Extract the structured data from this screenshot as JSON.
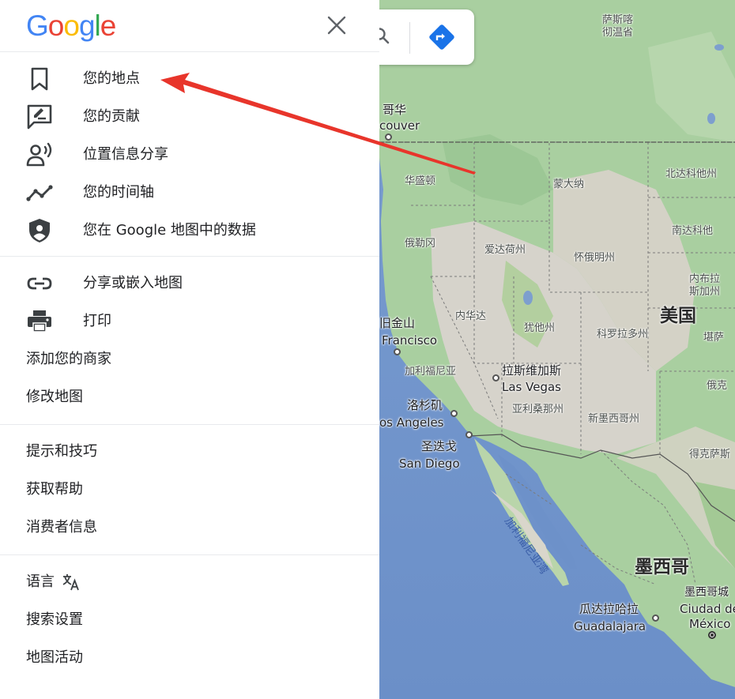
{
  "header": {
    "logo": "Google",
    "logo_colors": [
      "#4285F4",
      "#EA4335",
      "#FBBC05",
      "#4285F4",
      "#34A853",
      "#EA4335"
    ]
  },
  "menu": {
    "group1": [
      {
        "label": "您的地点",
        "icon": "bookmark-icon"
      },
      {
        "label": "您的贡献",
        "icon": "contribution-icon"
      },
      {
        "label": "位置信息分享",
        "icon": "location-sharing-icon"
      },
      {
        "label": "您的时间轴",
        "icon": "timeline-icon"
      },
      {
        "label": "您在 Google 地图中的数据",
        "icon": "shield-icon"
      }
    ],
    "group2": [
      {
        "label": "分享或嵌入地图",
        "icon": "link-icon"
      },
      {
        "label": "打印",
        "icon": "print-icon"
      },
      {
        "label": "添加您的商家"
      },
      {
        "label": "修改地图"
      }
    ],
    "group3": [
      {
        "label": "提示和技巧"
      },
      {
        "label": "获取帮助"
      },
      {
        "label": "消费者信息"
      }
    ],
    "group4": [
      {
        "label": "语言",
        "icon": "translate-icon"
      },
      {
        "label": "搜索设置"
      },
      {
        "label": "地图活动"
      }
    ]
  },
  "map": {
    "labels": {
      "saskatchewan": "萨斯喀\n彻温省",
      "vancouver_cn": "哥华",
      "vancouver_en": "couver",
      "washington": "华盛顿",
      "montana": "蒙大纳",
      "north_dakota": "北达科他州",
      "south_dakota": "南达科他",
      "oregon": "俄勒冈",
      "idaho": "爱达荷州",
      "wyoming": "怀俄明州",
      "nebraska": "内布拉\n斯加州",
      "usa": "美国",
      "sf_cn": "旧金山",
      "sf_en": "Francisco",
      "nevada": "内华达",
      "utah": "犹他州",
      "colorado": "科罗拉多州",
      "kansas": "堪萨",
      "california": "加利福尼亚",
      "lv_cn": "拉斯维加斯",
      "lv_en": "Las Vegas",
      "oklahoma": "俄克",
      "la_cn": "洛杉矶",
      "la_en": "os Angeles",
      "arizona": "亚利桑那州",
      "new_mexico": "新墨西哥州",
      "sd_cn": "圣迭戈",
      "sd_en": "San Diego",
      "texas": "得克萨斯",
      "gulf": "加利福尼亚湾",
      "mexico": "墨西哥",
      "mx_city_cn": "墨西哥城",
      "mx_city_en1": "Ciudad de",
      "mx_city_en2": "México",
      "gdl_cn": "瓜达拉哈拉",
      "gdl_en": "Guadalajara"
    }
  },
  "colors": {
    "land_green": "#a9cfa0",
    "land_dry": "#d6d3cb",
    "water": "#6d91c9",
    "annotation_arrow": "#e8352b"
  }
}
